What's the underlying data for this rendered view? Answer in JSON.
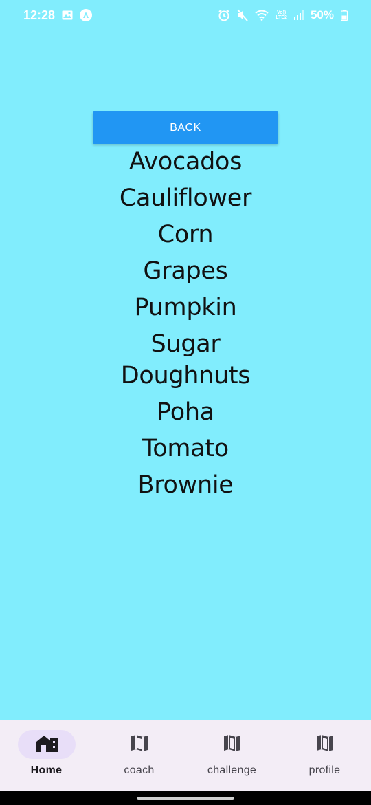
{
  "status_bar": {
    "time": "12:28",
    "battery": "50%",
    "network_label": "Vo))",
    "lte_label": "LTE2"
  },
  "back_button": {
    "label": "BACK"
  },
  "items": [
    "Avocados",
    "Cauliflower",
    "Corn",
    "Grapes",
    "Pumpkin",
    "Sugar Doughnuts",
    "Poha",
    "Tomato",
    "Brownie"
  ],
  "bottom_nav": {
    "items": [
      {
        "label": "Home",
        "icon": "home-icon",
        "active": true
      },
      {
        "label": "coach",
        "icon": "map-icon",
        "active": false
      },
      {
        "label": "challenge",
        "icon": "map-icon",
        "active": false
      },
      {
        "label": "profile",
        "icon": "map-icon",
        "active": false
      }
    ]
  },
  "colors": {
    "background": "#81edfd",
    "button": "#2196f3",
    "nav_background": "#f3edf6",
    "nav_active_pill": "#e8def8"
  }
}
